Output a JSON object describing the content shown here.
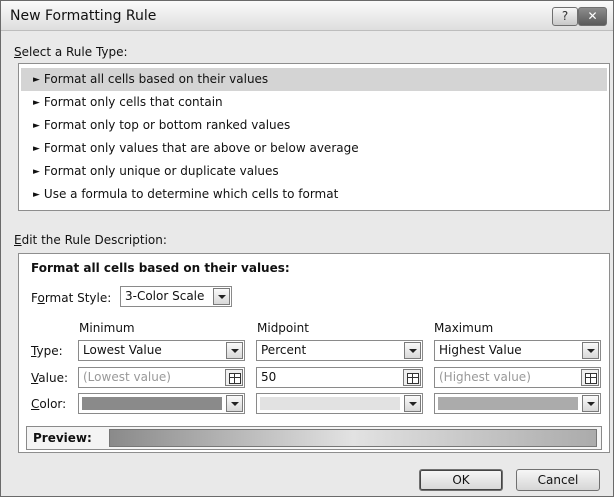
{
  "window": {
    "title": "New Formatting Rule",
    "help_glyph": "?",
    "close_glyph": "✕"
  },
  "select_rule": {
    "label_accel": "S",
    "label_rest": "elect a Rule Type:",
    "arrow_glyph": "►",
    "items": [
      {
        "label": "Format all cells based on their values",
        "selected": true
      },
      {
        "label": "Format only cells that contain",
        "selected": false
      },
      {
        "label": "Format only top or bottom ranked values",
        "selected": false
      },
      {
        "label": "Format only values that are above or below average",
        "selected": false
      },
      {
        "label": "Format only unique or duplicate values",
        "selected": false
      },
      {
        "label": "Use a formula to determine which cells to format",
        "selected": false
      }
    ]
  },
  "edit_rule": {
    "label_accel": "E",
    "label_rest": "dit the Rule Description:",
    "heading": "Format all cells based on their values:",
    "format_style": {
      "accel": "o",
      "pre": "F",
      "post": "rmat Style:",
      "value": "3-Color Scale"
    },
    "columns": {
      "minimum": "Minimum",
      "midpoint": "Midpoint",
      "maximum": "Maximum"
    },
    "row_labels": {
      "type": {
        "accel": "T",
        "rest": "ype:"
      },
      "value": {
        "accel": "V",
        "rest": "alue:"
      },
      "color": {
        "accel": "C",
        "rest": "olor:"
      }
    },
    "minimum": {
      "type": "Lowest Value",
      "value_placeholder": "(Lowest value)",
      "color": "#8a8a8a"
    },
    "midpoint": {
      "type": "Percent",
      "value": "50",
      "color": "#e2e2e2"
    },
    "maximum": {
      "type": "Highest Value",
      "value_placeholder": "(Highest value)",
      "color": "#ababab"
    },
    "preview": {
      "label": "Preview:",
      "gradient": [
        "#8a8a8a",
        "#e2e2e2",
        "#ababab"
      ]
    }
  },
  "buttons": {
    "ok": "OK",
    "cancel": "Cancel"
  },
  "icons": {
    "help": "help-icon",
    "close": "close-icon",
    "dropdown": "chevron-down-icon",
    "cell_ref": "cell-reference-icon"
  }
}
